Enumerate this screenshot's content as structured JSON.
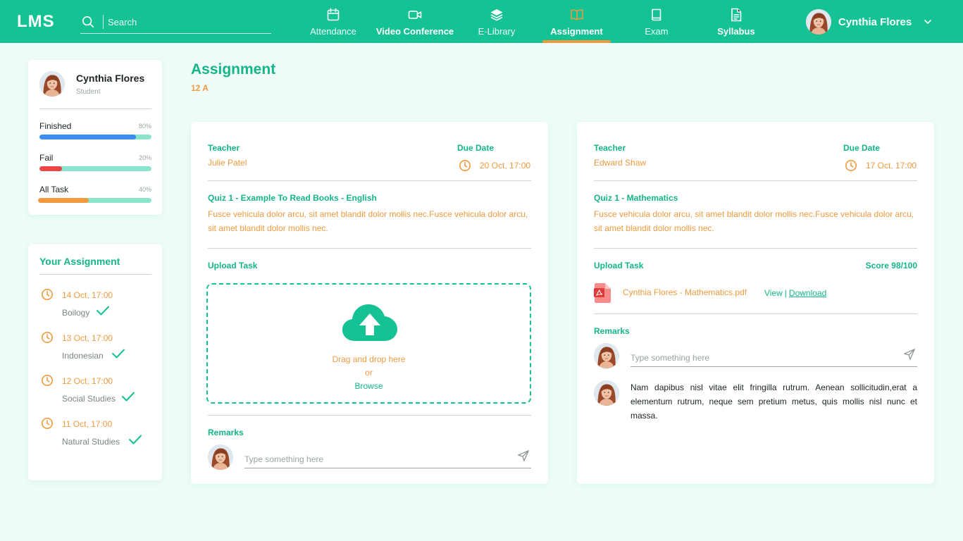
{
  "header": {
    "logo": "LMS",
    "search_placeholder": "Search",
    "nav": [
      {
        "label": "Attendance",
        "icon": "calendar-icon"
      },
      {
        "label": "Video Conference",
        "icon": "video-camera-icon"
      },
      {
        "label": "E-Library",
        "icon": "layers-icon"
      },
      {
        "label": "Assignment",
        "icon": "open-book-icon",
        "active": true
      },
      {
        "label": "Exam",
        "icon": "book-icon"
      },
      {
        "label": "Syllabus",
        "icon": "document-icon"
      }
    ],
    "user_name": "Cynthia Flores"
  },
  "profile": {
    "name": "Cynthia Flores",
    "role": "Student",
    "stats": [
      {
        "label": "Finished",
        "pct_label": "80%",
        "value": 0.86,
        "color": "#3b8ef0"
      },
      {
        "label": "Fail",
        "pct_label": "20%",
        "value": 0.2,
        "color": "#ef4444"
      },
      {
        "label": "All Task",
        "pct_label": "40%",
        "value": 0.45,
        "color": "#f49a3e"
      }
    ]
  },
  "your_assignment": {
    "title": "Your Assignment",
    "items": [
      {
        "date": "14 Oct, 17:00",
        "subject": "Boilogy"
      },
      {
        "date": "13 Oct, 17:00",
        "subject": "Indonesian"
      },
      {
        "date": "12 Oct, 17:00",
        "subject": "Social Studies"
      },
      {
        "date": "11 Oct, 17:00",
        "subject": "Natural Studies"
      }
    ]
  },
  "page": {
    "title": "Assignment",
    "class": "12 A"
  },
  "tasks": [
    {
      "teacher_label": "Teacher",
      "teacher": "Julie Patel",
      "due_label": "Due Date",
      "due": "20 Oct, 17:00",
      "quiz_title": "Quiz 1 - Example To Read Books - English",
      "description": "Fusce vehicula dolor arcu, sit amet blandit dolor mollis nec.Fusce vehicula dolor arcu, sit amet blandit dolor mollis nec.",
      "upload_label": "Upload Task",
      "dropzone": {
        "line1": "Drag and drop here",
        "line2": "or",
        "browse": "Browse"
      },
      "remarks_label": "Remarks",
      "remarks_placeholder": "Type something here"
    },
    {
      "teacher_label": "Teacher",
      "teacher": "Edward Shaw",
      "due_label": "Due Date",
      "due": "17 Oct, 17:00",
      "quiz_title": "Quiz 1 - Mathematics",
      "description": "Fusce vehicula dolor arcu, sit amet blandit dolor mollis nec.Fusce vehicula dolor arcu, sit amet blandit dolor mollis nec.",
      "upload_label": "Upload Task",
      "score": "Score 98/100",
      "file_name": "Cynthia Flores - Mathematics.pdf",
      "view_label": "View",
      "separator": "|",
      "download_label": "Download",
      "remarks_label": "Remarks",
      "remarks_placeholder": "Type something here",
      "comment": "Nam dapibus nisl vitae elit fringilla rutrum. Aenean sollicitudin,erat a elementum rutrum, neque sem pretium metus, quis mollis nisl nunc et massa."
    }
  ]
}
